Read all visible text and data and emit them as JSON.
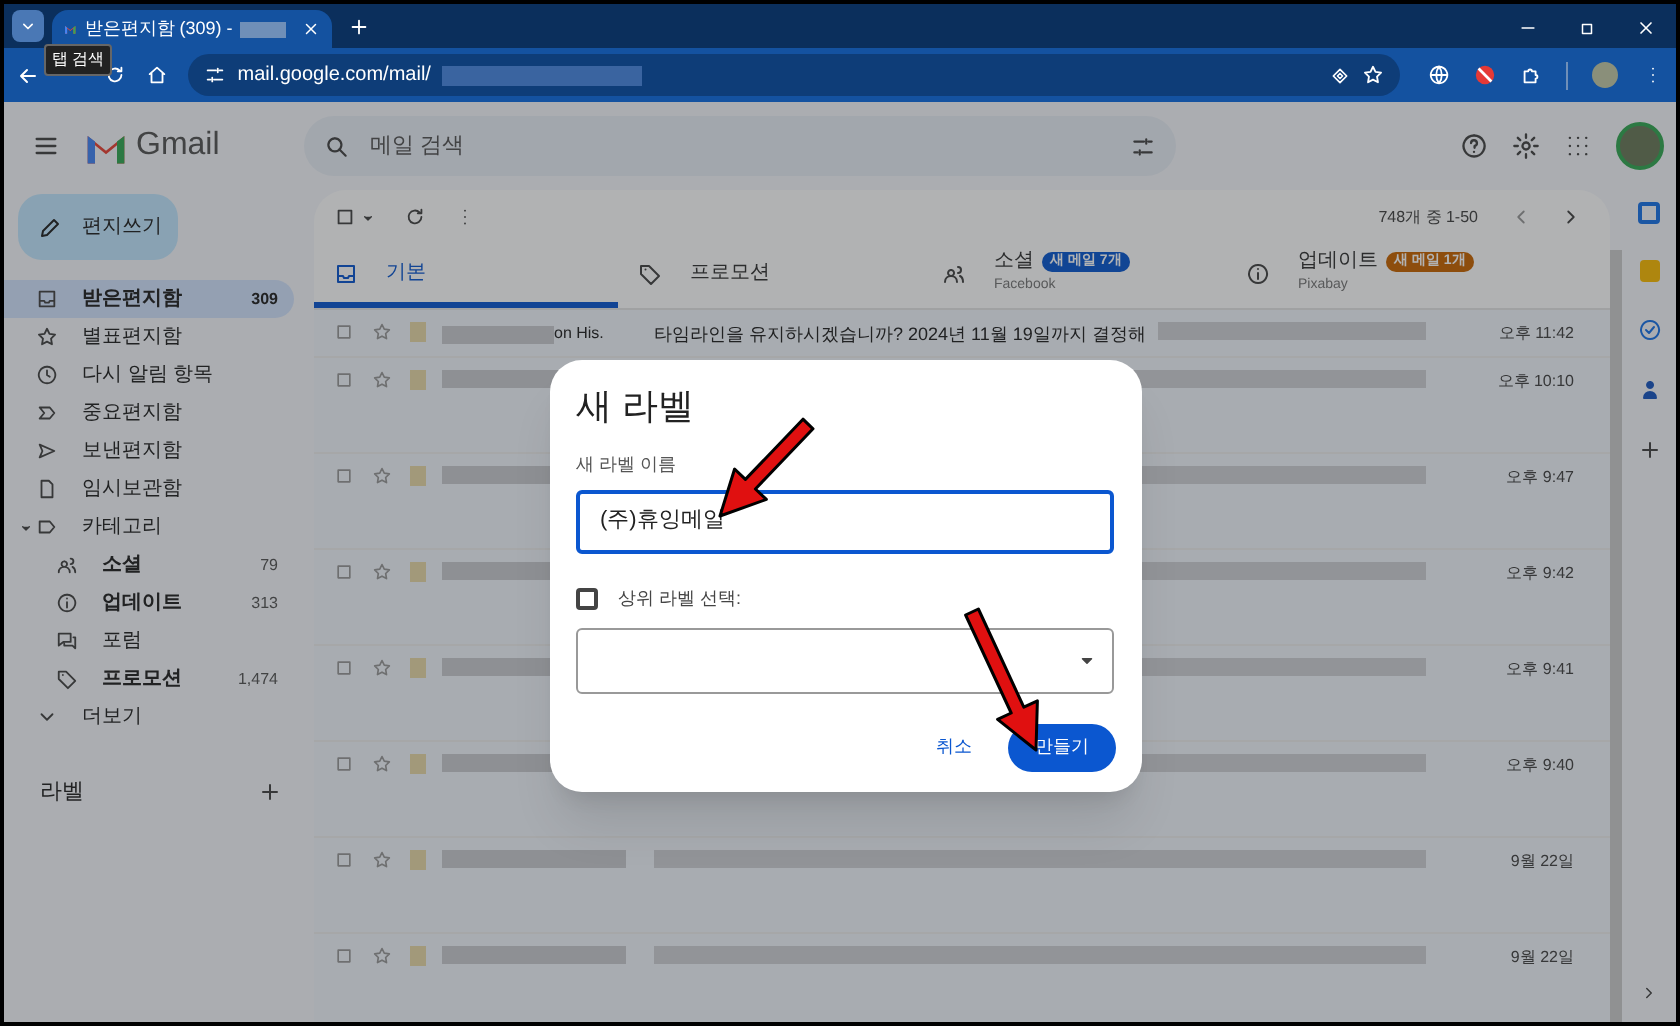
{
  "browser": {
    "tab_title": "받은편지함 (309) -",
    "tooltip": "탭 검색",
    "url": "mail.google.com/mail/"
  },
  "gmail": {
    "app_name": "Gmail",
    "search": {
      "placeholder": "메일 검색"
    },
    "compose": "편지쓰기",
    "folders": [
      {
        "label": "받은편지함",
        "count": "309",
        "selected": true
      },
      {
        "label": "별표편지함",
        "selected": false
      },
      {
        "label": "다시 알림 항목",
        "selected": false
      },
      {
        "label": "중요편지함",
        "selected": false
      },
      {
        "label": "보낸편지함",
        "selected": false
      },
      {
        "label": "임시보관함",
        "selected": false
      },
      {
        "label": "카테고리",
        "selected": false,
        "expanded": true,
        "children": [
          {
            "label": "소셜",
            "count": "79",
            "unread": true,
            "selected": false
          },
          {
            "label": "업데이트",
            "count": "313",
            "unread": true,
            "selected": false
          },
          {
            "label": "포럼",
            "unread": false,
            "selected": false
          },
          {
            "label": "프로모션",
            "count": "1,474",
            "unread": true,
            "selected": false
          }
        ]
      },
      {
        "label": "더보기",
        "selected": false
      }
    ],
    "labels_heading": "라벨",
    "page_info": "748개 중 1-50",
    "tabs": [
      {
        "label": "기본",
        "selected": true
      },
      {
        "label": "프로모션",
        "selected": false
      },
      {
        "label": "소셜",
        "badge": "새 메일 7개",
        "color": "#124594",
        "sub": "Facebook",
        "selected": false
      },
      {
        "label": "업데이트",
        "badge": "새 메일 1개",
        "color": "#8d4d0d",
        "sub": "Pixabay",
        "selected": false
      }
    ],
    "rows": [
      {
        "sender": "on His.",
        "subject": "타임라인을 유지하시겠습니까? 2024년 11월 19일까지 결정해",
        "time": "오후 11:42"
      },
      {
        "time": "오후 10:10"
      },
      {
        "time": "오후 9:47"
      },
      {
        "time": "오후 9:42"
      },
      {
        "time": "오후 9:41"
      },
      {
        "time": "오후 9:40"
      },
      {
        "time": "9월 22일"
      },
      {
        "time": "9월 22일"
      }
    ]
  },
  "dialog": {
    "title": "새 라벨",
    "name_label": "새 라벨 이름",
    "name_value": "(주)휴잉메일",
    "parent_checkbox": {
      "label": "상위 라벨 선택:",
      "checked": false
    },
    "buttons": [
      {
        "label": "취소",
        "kind": "text"
      },
      {
        "label": "만들기",
        "kind": "primary"
      }
    ]
  }
}
